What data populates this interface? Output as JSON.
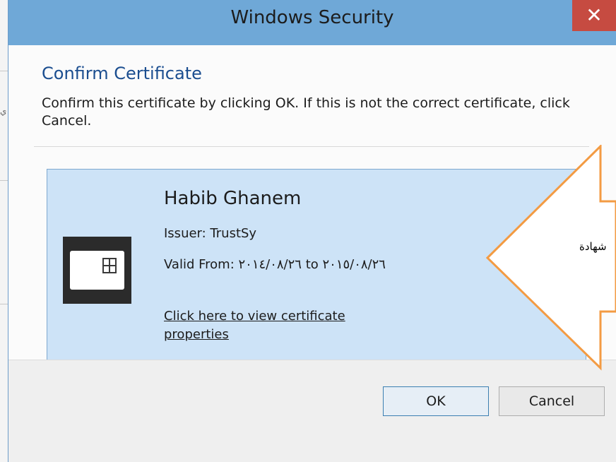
{
  "window": {
    "title": "Windows Security",
    "close_glyph": "✕"
  },
  "dialog": {
    "heading": "Confirm Certificate",
    "description": "Confirm this certificate by clicking OK. If this is not the correct certificate, click Cancel."
  },
  "certificate": {
    "name": "Habib Ghanem",
    "issuer": "Issuer: TrustSy",
    "valid": "Valid From: ٢٠١٤/٠٨/٢٦ to ٢٠١٥/٠٨/٢٦",
    "link": "Click here to view certificate properties"
  },
  "buttons": {
    "ok": "OK",
    "cancel": "Cancel"
  },
  "annotation": {
    "label": "شهادة"
  },
  "background": {
    "edge_char": "ي"
  },
  "colors": {
    "titlebar": "#6fa8d7",
    "close": "#c64b41",
    "heading": "#1a4d8f",
    "tile": "#cde3f7",
    "arrow": "#f39b43"
  }
}
